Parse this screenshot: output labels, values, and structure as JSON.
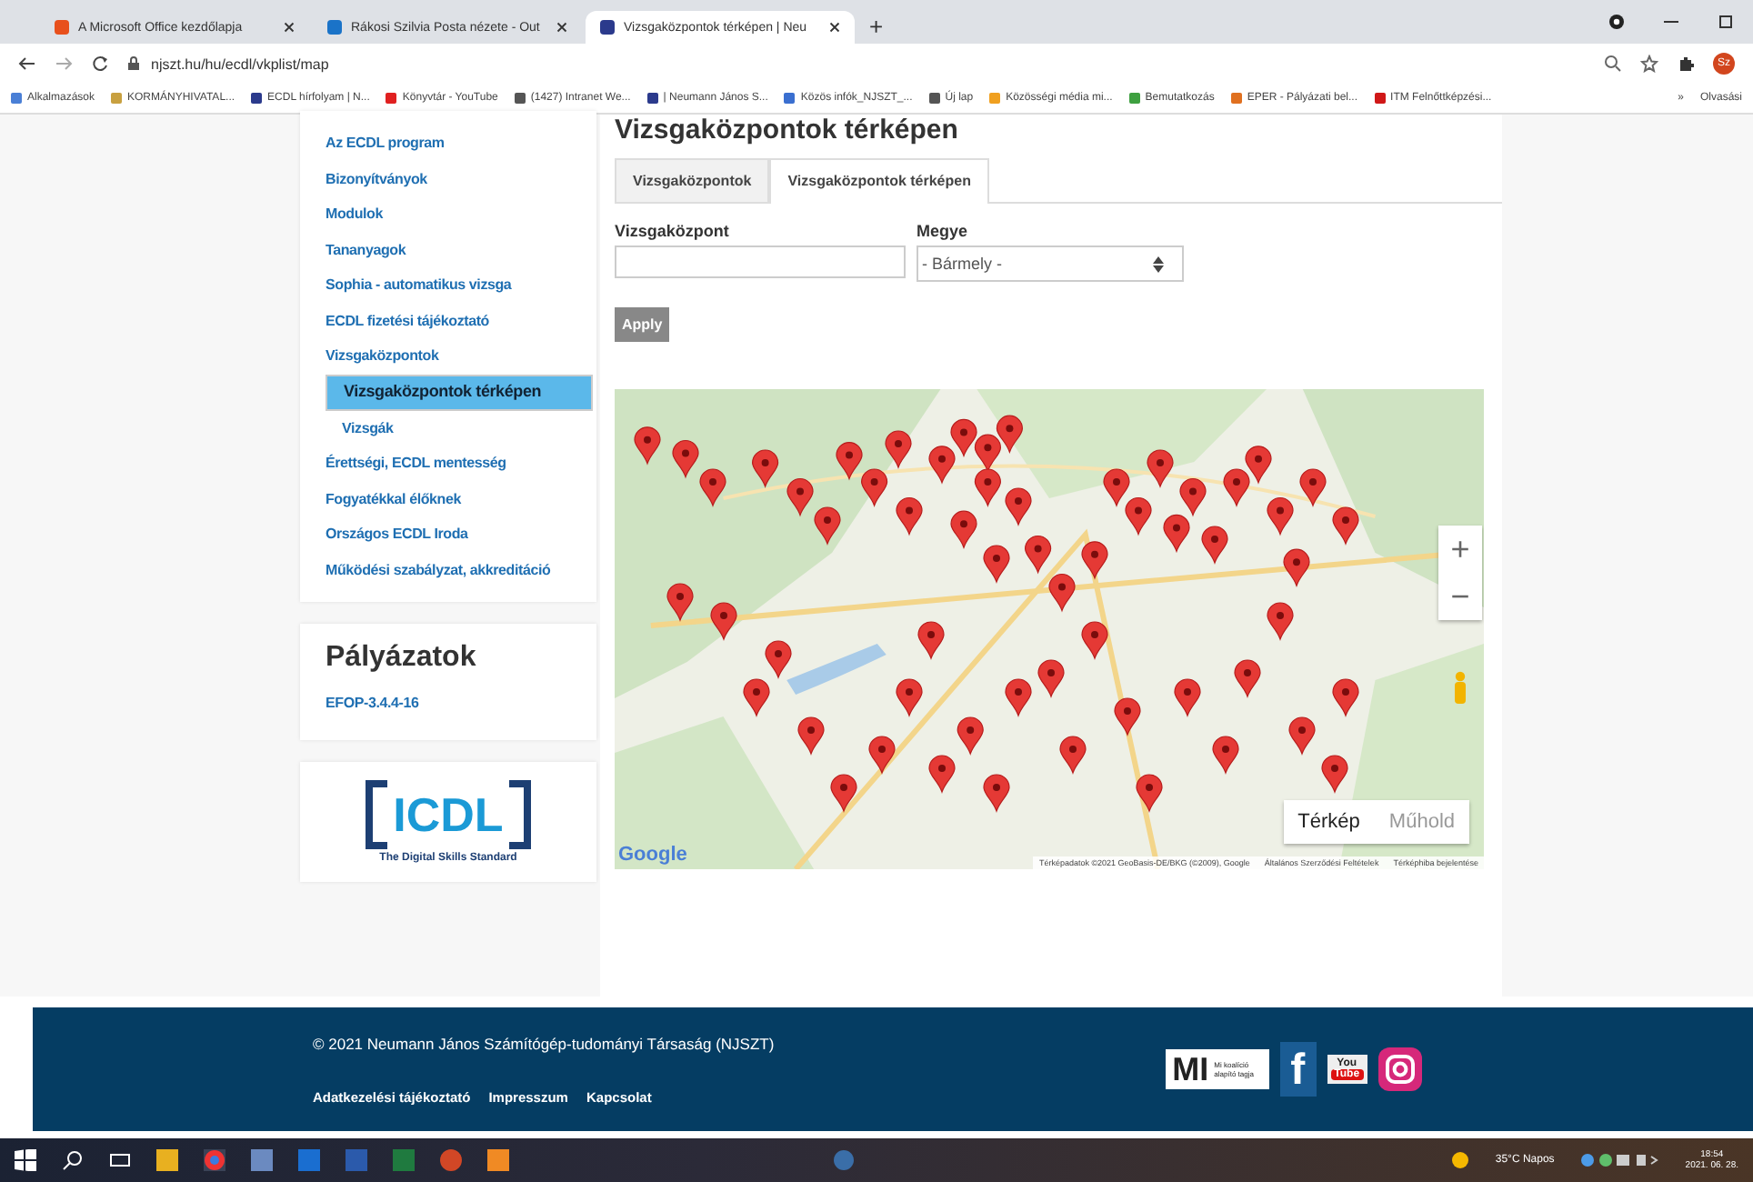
{
  "browser": {
    "tabs": [
      {
        "title": "A Microsoft Office kezdőlapja",
        "selected": false,
        "color": "#e8501c"
      },
      {
        "title": "Rákosi Szilvia Posta nézete - Out",
        "selected": false,
        "color": "#1a73c8"
      },
      {
        "title": "Vizsgaközpontok térképen | Neu",
        "selected": true,
        "color": "#2b3a8c"
      }
    ],
    "new_tab": "+",
    "url": "njszt.hu/hu/ecdl/vkplist/map",
    "avatar": "Sz",
    "bookmarks": [
      {
        "label": "Alkalmazások",
        "color": "#4a7fd6"
      },
      {
        "label": "KORMÁNYHIVATAL...",
        "color": "#c8a040"
      },
      {
        "label": "ECDL hírfolyam | N...",
        "color": "#2b3a8c"
      },
      {
        "label": "Könyvtár - YouTube",
        "color": "#e02020"
      },
      {
        "label": "(1427) Intranet We...",
        "color": "#555555"
      },
      {
        "label": "| Neumann János S...",
        "color": "#2b3a8c"
      },
      {
        "label": "Közös infók_NJSZT_...",
        "color": "#3a6fd0"
      },
      {
        "label": "Új lap",
        "color": "#555555"
      },
      {
        "label": "Közösségi média mi...",
        "color": "#f0a020"
      },
      {
        "label": "Bemutatkozás",
        "color": "#3ea040"
      },
      {
        "label": "EPER - Pályázati bel...",
        "color": "#e07020"
      },
      {
        "label": "ITM Felnőttképzési...",
        "color": "#d01818"
      }
    ],
    "more": "»",
    "reading_list": "Olvasási"
  },
  "sidebar": {
    "items": [
      {
        "label": "Az ECDL program",
        "selected": false
      },
      {
        "label": "Bizonyítványok",
        "selected": false
      },
      {
        "label": "Modulok",
        "selected": false
      },
      {
        "label": "Tananyagok",
        "selected": false
      },
      {
        "label": "Sophia - automatikus vizsga",
        "selected": false
      },
      {
        "label": "ECDL fizetési tájékoztató",
        "selected": false
      },
      {
        "label": "Vizsgaközpontok",
        "selected": false,
        "children": [
          {
            "label": "Vizsgaközpontok térképen",
            "selected": true
          },
          {
            "label": "Vizsgák",
            "selected": false
          }
        ]
      },
      {
        "label": "Érettségi, ECDL mentesség",
        "selected": false
      },
      {
        "label": "Fogyatékkal élőknek",
        "selected": false
      },
      {
        "label": "Országos ECDL Iroda",
        "selected": false
      },
      {
        "label": "Működési szabályzat, akkreditáció",
        "selected": false
      }
    ],
    "tenders": {
      "title": "Pályázatok",
      "links": [
        "EFOP-3.4.4-16"
      ]
    },
    "logo": {
      "name": "ICDL",
      "tagline": "The Digital Skills Standard"
    }
  },
  "content": {
    "title": "Vizsgaközpontok térképen",
    "tabs": [
      {
        "label": "Vizsgaközpontok",
        "selected": false
      },
      {
        "label": "Vizsgaközpontok térképen",
        "selected": true
      }
    ],
    "filters": {
      "center_label": "Vizsgaközpont",
      "county_label": "Megye",
      "county_value": "- Bármely -",
      "apply": "Apply"
    },
    "map": {
      "kind": "picture",
      "zoom_in": "+",
      "zoom_out": "−",
      "types": [
        {
          "label": "Térkép",
          "selected": true
        },
        {
          "label": "Műhold",
          "selected": false
        }
      ],
      "brand": "Google",
      "attribution": [
        "Térképadatok ©2021 GeoBasis-DE/BKG (©2009), Google",
        "Általános Szerződési Feltételek",
        "Térképhiba bejelentése"
      ]
    }
  },
  "footer": {
    "copyright": "© 2021 Neumann János Számítógép-tudományi Társaság (NJSZT)",
    "links": [
      "Adatkezelési tájékoztató",
      "Impresszum",
      "Kapcsolat"
    ],
    "badge": {
      "mark": "MI",
      "text": "Mi koalíció alapító tagja"
    },
    "facebook": "f",
    "youtube_top": "You",
    "youtube_bottom": "Tube"
  },
  "taskbar": {
    "weather": "35°C Napos",
    "time": "18:54",
    "date": "2021. 06. 28."
  }
}
